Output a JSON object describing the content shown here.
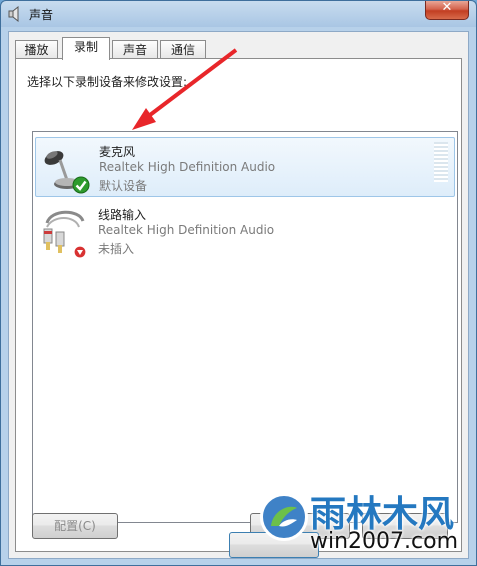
{
  "window": {
    "title": "声音",
    "close_glyph": "✕"
  },
  "tabs": [
    {
      "label": "播放",
      "active": false
    },
    {
      "label": "录制",
      "active": true
    },
    {
      "label": "声音",
      "active": false
    },
    {
      "label": "通信",
      "active": false
    }
  ],
  "instruction": "选择以下录制设备来修改设置:",
  "devices": [
    {
      "name": "麦克风",
      "description": "Realtek High Definition Audio",
      "status": "默认设备",
      "icon": "microphone-icon",
      "badge": "green-check-icon",
      "selected": true
    },
    {
      "name": "线路输入",
      "description": "Realtek High Definition Audio",
      "status": "未插入",
      "icon": "line-in-jack-icon",
      "badge": "red-down-arrow-icon",
      "selected": false
    }
  ],
  "buttons": {
    "configure": "配置(C)"
  },
  "annotation": {
    "arrow_color": "#e8262a"
  },
  "watermark": {
    "brand": "雨林木风",
    "url": "win2007.com"
  }
}
